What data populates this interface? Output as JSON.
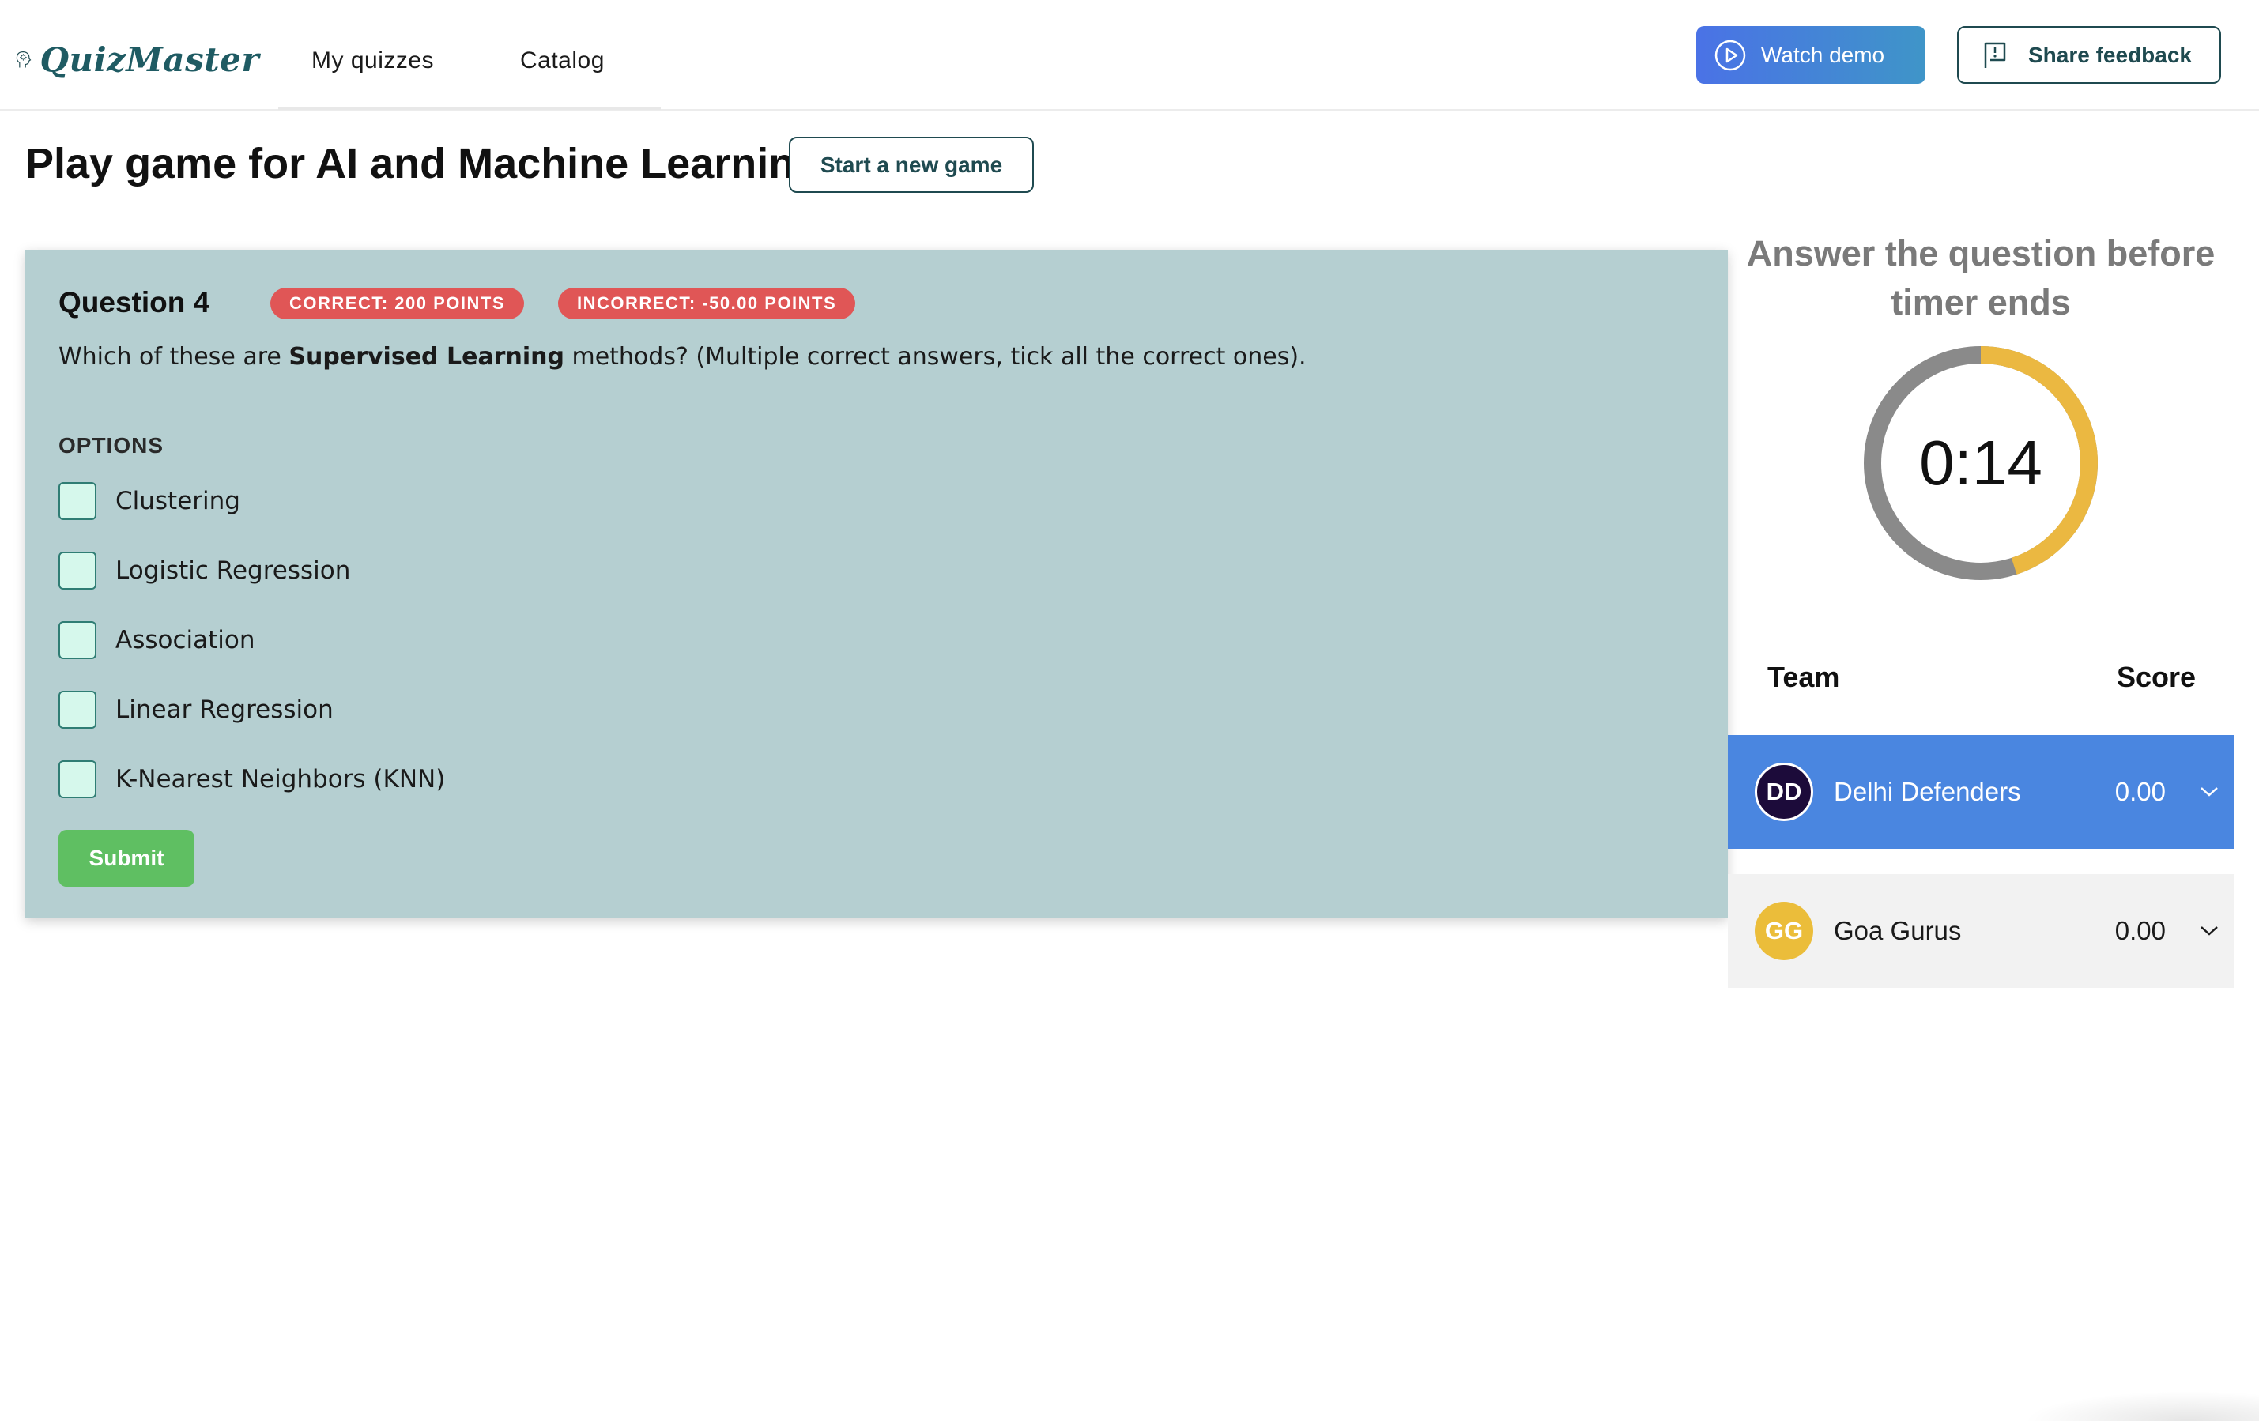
{
  "app": {
    "name": "QuizMaster"
  },
  "nav": {
    "my_quizzes": "My quizzes",
    "catalog": "Catalog"
  },
  "header": {
    "watch_demo": "Watch demo",
    "share_feedback": "Share feedback"
  },
  "page": {
    "title": "Play game for AI and Machine Learning",
    "new_game_button": "Start a new game"
  },
  "question": {
    "title": "Question 4",
    "correct_badge": "CORRECT: 200 POINTS",
    "incorrect_badge": "INCORRECT: -50.00 POINTS",
    "text_before": "Which of these are ",
    "text_bold": "Supervised Learning",
    "text_after": " methods? (Multiple correct answers, tick all the correct ones).",
    "options_heading": "OPTIONS",
    "options": [
      {
        "label": "Clustering",
        "checked": false
      },
      {
        "label": "Logistic Regression",
        "checked": false
      },
      {
        "label": "Association",
        "checked": false
      },
      {
        "label": "Linear Regression",
        "checked": false
      },
      {
        "label": "K-Nearest Neighbors (KNN)",
        "checked": false
      }
    ],
    "submit_label": "Submit"
  },
  "timer": {
    "hint": "Answer the question before timer ends",
    "value": "0:14",
    "remaining_fraction": 0.45
  },
  "scoreboard": {
    "team_header": "Team",
    "score_header": "Score",
    "teams": [
      {
        "initials": "DD",
        "name": "Delhi Defenders",
        "score": "0.00",
        "active": true
      },
      {
        "initials": "GG",
        "name": "Goa Gurus",
        "score": "0.00",
        "active": false
      }
    ]
  },
  "colors": {
    "panel": "#b5cfd1",
    "badge": "#e05656",
    "submit": "#5fbf62",
    "active_team": "#4a86e0",
    "timer_progress": "#ebb841",
    "timer_track": "#8a8a8a"
  }
}
